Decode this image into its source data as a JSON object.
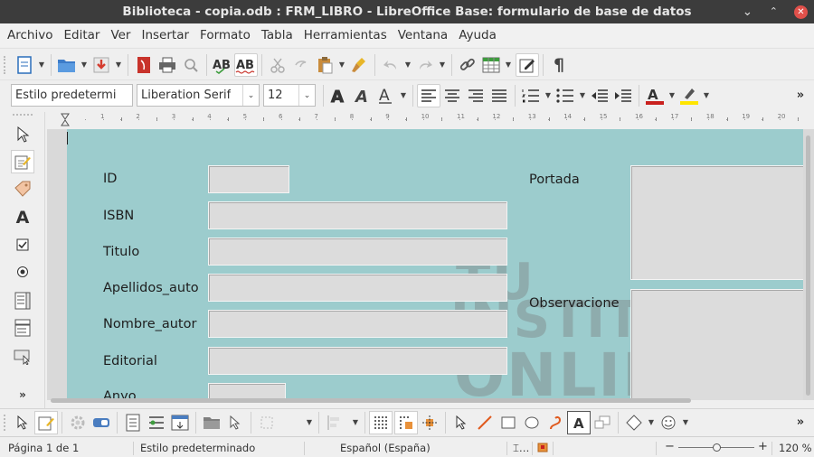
{
  "window": {
    "title": "Biblioteca - copia.odb : FRM_LIBRO - LibreOffice Base: formulario de base de datos"
  },
  "menu": [
    "Archivo",
    "Editar",
    "Ver",
    "Insertar",
    "Formato",
    "Tabla",
    "Herramientas",
    "Ventana",
    "Ayuda"
  ],
  "format_toolbar": {
    "paragraph_style": "Estilo predetermi",
    "font_name": "Liberation Serif",
    "font_size": "12"
  },
  "ruler": {
    "ticks": [
      "1",
      "2",
      "3",
      "4",
      "5",
      "6",
      "7",
      "8",
      "9",
      "10",
      "11",
      "12",
      "13",
      "14",
      "15",
      "16",
      "17",
      "18",
      "19",
      "20"
    ]
  },
  "form": {
    "labels": {
      "id": "ID",
      "isbn": "ISBN",
      "titulo": "Titulo",
      "apellidos": "Apellidos_auto",
      "nombre": "Nombre_autor",
      "editorial": "Editorial",
      "anyo": "Anyo",
      "portada": "Portada",
      "observaciones": "Observacione"
    }
  },
  "watermark": {
    "line1": "TU",
    "line2": "INSTITUTO",
    "line3": "ONLINE"
  },
  "statusbar": {
    "page": "Página 1 de 1",
    "style": "Estilo predeterminado",
    "language": "Español (España)",
    "zoom": "120 %"
  },
  "colors": {
    "form_bg": "#9ccccd",
    "title_bg": "#3c3c3c",
    "font_color": "#c9211e",
    "highlight": "#ffe500"
  }
}
